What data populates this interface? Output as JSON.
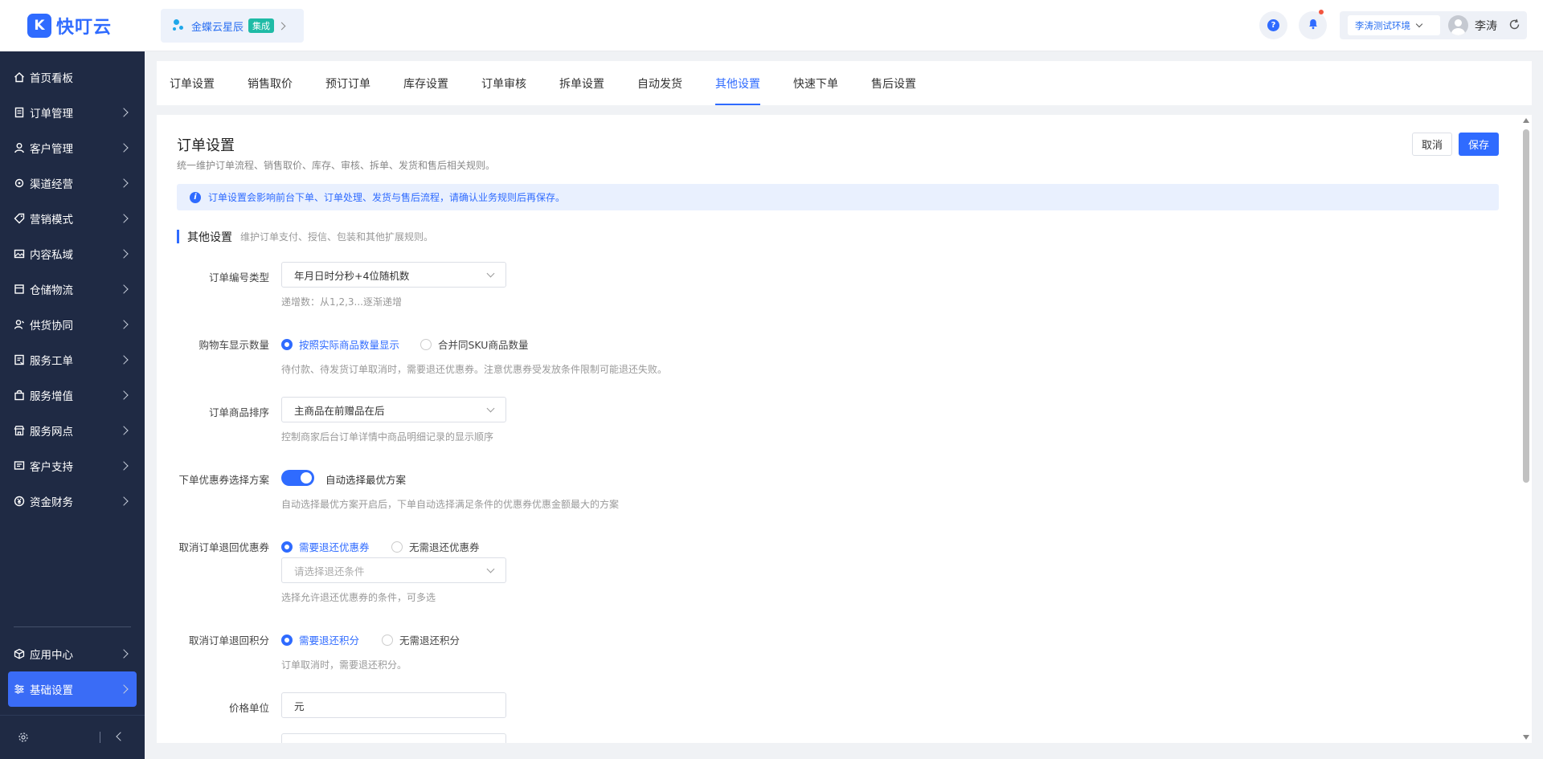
{
  "app": {
    "logo_mark": "K",
    "logo_text": "快叮云"
  },
  "header": {
    "app_name": "金蝶云星辰",
    "app_tag": "集成",
    "env_name": "李涛测试环境",
    "user_name": "李涛",
    "help_glyph": "?"
  },
  "sidebar": {
    "items": [
      {
        "label": "首页看板",
        "icon": "home-icon"
      },
      {
        "label": "订单管理",
        "icon": "order-icon"
      },
      {
        "label": "客户管理",
        "icon": "user-icon"
      },
      {
        "label": "渠道经营",
        "icon": "channel-icon"
      },
      {
        "label": "营销模式",
        "icon": "tag-icon"
      },
      {
        "label": "内容私域",
        "icon": "image-icon"
      },
      {
        "label": "仓储物流",
        "icon": "box-icon"
      },
      {
        "label": "供货协同",
        "icon": "supply-icon"
      },
      {
        "label": "服务工单",
        "icon": "ticket-icon"
      },
      {
        "label": "服务增值",
        "icon": "bag-icon"
      },
      {
        "label": "服务网点",
        "icon": "store-icon"
      },
      {
        "label": "客户支持",
        "icon": "support-icon"
      },
      {
        "label": "资金财务",
        "icon": "yen-icon"
      }
    ],
    "bottom_items": [
      {
        "label": "应用中心",
        "icon": "cube-icon"
      },
      {
        "label": "基础设置",
        "icon": "settings-sliders-icon"
      }
    ]
  },
  "tabs": [
    "订单设置",
    "销售取价",
    "预订订单",
    "库存设置",
    "订单审核",
    "拆单设置",
    "自动发货",
    "其他设置",
    "快速下单",
    "售后设置"
  ],
  "active_tab_index": 7,
  "panel": {
    "title": "订单设置",
    "description": "统一维护订单流程、销售取价、库存、审核、拆单、发货和售后相关规则。",
    "cancel_label": "取消",
    "save_label": "保存",
    "alert_glyph": "i",
    "alert_text": "订单设置会影响前台下单、订单处理、发货与售后流程，请确认业务规则后再保存。",
    "section_title": "其他设置",
    "section_desc": "维护订单支付、授信、包装和其他扩展规则。",
    "fields": {
      "order_no_type": {
        "label": "订单编号类型",
        "value": "年月日时分秒+4位随机数",
        "hint": "递增数：从1,2,3...逐渐递增"
      },
      "cart_qty": {
        "label": "购物车显示数量",
        "opt1": "按照实际商品数量显示",
        "opt2": "合并同SKU商品数量",
        "hint": "待付款、待发货订单取消时，需要退还优惠券。注意优惠券受发放条件限制可能退还失败。"
      },
      "item_sort": {
        "label": "订单商品排序",
        "value": "主商品在前赠品在后",
        "hint": "控制商家后台订单详情中商品明细记录的显示顺序"
      },
      "coupon_plan": {
        "label": "下单优惠券选择方案",
        "switch_label": "自动选择最优方案",
        "hint": "自动选择最优方案开启后，下单自动选择满足条件的优惠券优惠金额最大的方案"
      },
      "cancel_coupon": {
        "label": "取消订单退回优惠券",
        "opt1": "需要退还优惠券",
        "opt2": "无需退还优惠券",
        "placeholder": "请选择退还条件",
        "hint": "选择允许退还优惠券的条件，可多选"
      },
      "cancel_points": {
        "label": "取消订单退回积分",
        "opt1": "需要退还积分",
        "opt2": "无需退还积分",
        "hint": "订单取消时，需要退还积分。"
      },
      "price_unit": {
        "label": "价格单位",
        "value": "元"
      }
    }
  }
}
